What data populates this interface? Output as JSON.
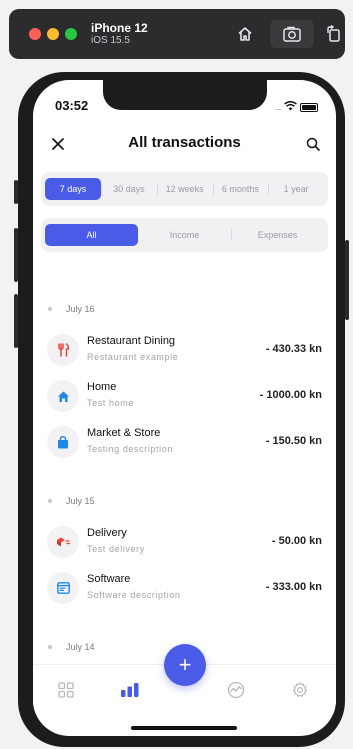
{
  "simulator": {
    "device_name": "iPhone 12",
    "os_version": "iOS 15.5",
    "home_icon": "home-icon",
    "screenshot_icon": "camera-icon",
    "rotate_icon": "rotate-icon"
  },
  "status_bar": {
    "time": "03:52",
    "signal": "....",
    "wifi_icon": "wifi-icon",
    "battery_icon": "battery-icon"
  },
  "header": {
    "title": "All transactions",
    "close_icon": "close-icon",
    "search_icon": "search-icon"
  },
  "range_filter": {
    "options": [
      "7 days",
      "30 days",
      "12 weeks",
      "6 months",
      "1 year"
    ],
    "selected": "7 days"
  },
  "type_filter": {
    "options": [
      "All",
      "Income",
      "Expenses"
    ],
    "selected": "All"
  },
  "groups": [
    {
      "date": "July 16",
      "transactions": [
        {
          "name": "Restaurant Dining",
          "description": "Restaurant example",
          "amount": "- 430.33 kn",
          "icon": "fork-knife-icon",
          "color": "#e8473b"
        },
        {
          "name": "Home",
          "description": "Test home",
          "amount": "- 1000.00 kn",
          "icon": "home-icon",
          "color": "#1e88e5"
        },
        {
          "name": "Market & Store",
          "description": "Testing description",
          "amount": "- 150.50 kn",
          "icon": "shopping-bag-icon",
          "color": "#1e88e5"
        }
      ]
    },
    {
      "date": "July 15",
      "transactions": [
        {
          "name": "Delivery",
          "description": "Test delivery",
          "amount": "- 50.00 kn",
          "icon": "delivery-icon",
          "color": "#e8473b"
        },
        {
          "name": "Software",
          "description": "Software description",
          "amount": "- 333.00 kn",
          "icon": "software-icon",
          "color": "#1e88e5"
        }
      ]
    },
    {
      "date": "July 14",
      "transactions": []
    }
  ],
  "tab_bar": {
    "tabs": [
      {
        "icon": "grid-icon",
        "active": false
      },
      {
        "icon": "bar-chart-icon",
        "active": true
      },
      {
        "icon": "trend-icon",
        "active": false
      },
      {
        "icon": "gear-icon",
        "active": false
      }
    ],
    "fab_label": "+",
    "fab_icon": "plus-icon"
  },
  "colors": {
    "accent": "#4a5be8",
    "text_primary": "#111111",
    "text_muted": "#a3a3ab",
    "expense_red": "#e8473b",
    "info_blue": "#1e88e5"
  }
}
